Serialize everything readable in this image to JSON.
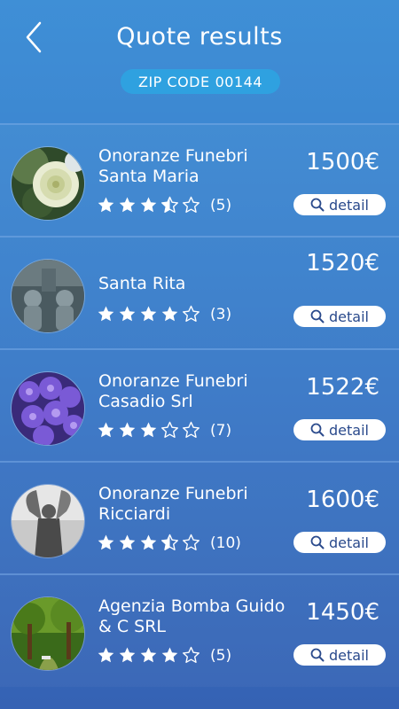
{
  "header": {
    "title": "Quote results",
    "zip_label": "ZIP CODE",
    "zip_value": "00144"
  },
  "detail_label": "detail",
  "colors": {
    "background_top": "#3f8fd6",
    "background_bottom": "#3562b4",
    "zip_pill": "#2fa1e0",
    "button_text": "#2a4a8c"
  },
  "results": [
    {
      "name_line1": "Onoranze Funebri",
      "name_line2": "Santa Maria",
      "price": "1500€",
      "rating": 3.5,
      "count": "(5)",
      "image": "white-rose"
    },
    {
      "name_line1": "Santa Rita",
      "name_line2": "",
      "price": "1520€",
      "rating": 4,
      "count": "(3)",
      "image": "stone-angels"
    },
    {
      "name_line1": "Onoranze Funebri",
      "name_line2": "Casadio Srl",
      "price": "1522€",
      "rating": 3,
      "count": "(7)",
      "image": "purple-hyacinth"
    },
    {
      "name_line1": "Onoranze Funebri",
      "name_line2": "Ricciardi",
      "price": "1600€",
      "rating": 3.5,
      "count": "(10)",
      "image": "angel-statue"
    },
    {
      "name_line1": "Agenzia Bomba Guido",
      "name_line2": "& C SRL",
      "price": "1450€",
      "rating": 4,
      "count": "(5)",
      "image": "park-trees"
    }
  ]
}
